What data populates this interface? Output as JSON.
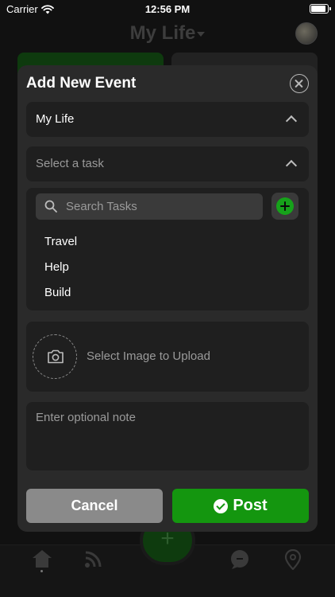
{
  "status_bar": {
    "carrier": "Carrier",
    "time": "12:56 PM",
    "battery_level": 0.9
  },
  "background": {
    "header_title": "My Life",
    "tab_icons": [
      "home-icon",
      "feed-icon",
      "add-icon",
      "chat-icon",
      "location-icon"
    ]
  },
  "modal": {
    "title": "Add New Event",
    "project_select_value": "My Life",
    "task_select_placeholder": "Select a task",
    "search_placeholder": "Search Tasks",
    "tasks": [
      {
        "label": "Travel"
      },
      {
        "label": "Help"
      },
      {
        "label": "Build"
      }
    ],
    "image_upload_label": "Select Image to Upload",
    "note_placeholder": "Enter optional note",
    "cancel_label": "Cancel",
    "post_label": "Post"
  },
  "colors": {
    "accent_green": "#14960f",
    "cancel_gray": "#8a8a8a",
    "modal_bg": "#2a2a2a",
    "field_bg": "#1f1f1f"
  }
}
